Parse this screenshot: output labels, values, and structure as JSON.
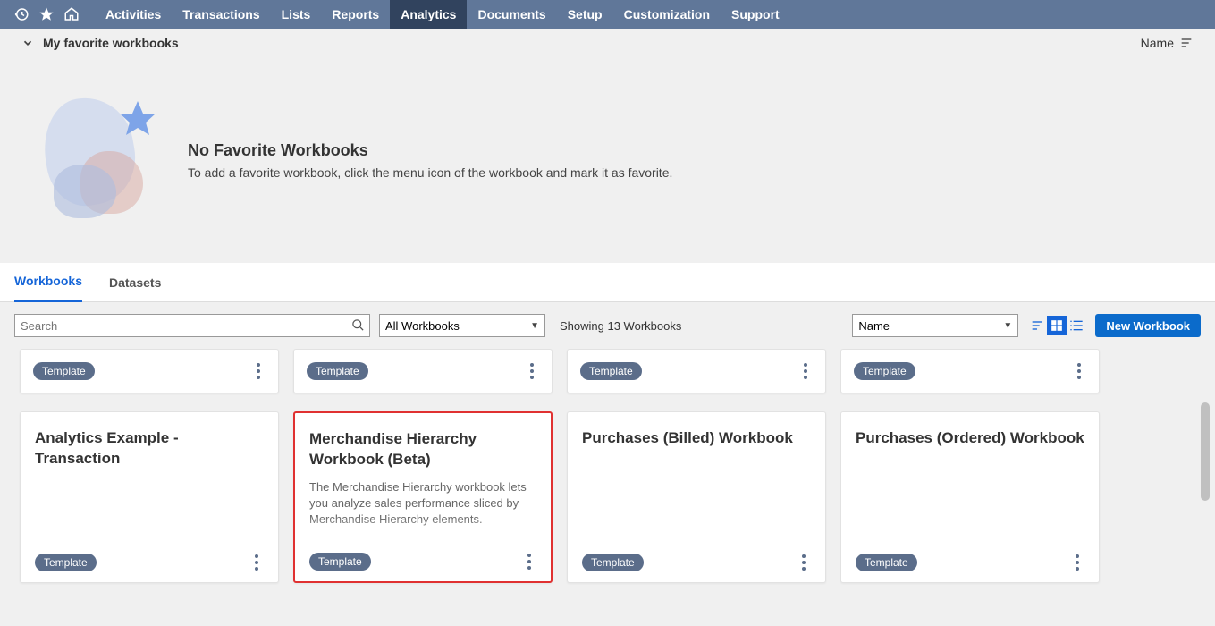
{
  "nav": {
    "items": [
      "Activities",
      "Transactions",
      "Lists",
      "Reports",
      "Analytics",
      "Documents",
      "Setup",
      "Customization",
      "Support"
    ],
    "active_index": 4
  },
  "favorites": {
    "header": "My favorite workbooks",
    "sort_label": "Name",
    "empty_title": "No Favorite Workbooks",
    "empty_text": "To add a favorite workbook, click the menu icon of the workbook and mark it as favorite."
  },
  "tabs": {
    "items": [
      "Workbooks",
      "Datasets"
    ],
    "active_index": 0
  },
  "toolbar": {
    "search_placeholder": "Search",
    "filter_value": "All Workbooks",
    "showing_text": "Showing 13 Workbooks",
    "sort_value": "Name",
    "new_button": "New Workbook"
  },
  "badge_label": "Template",
  "top_cards": [
    {
      "badge": "Template"
    },
    {
      "badge": "Template"
    },
    {
      "badge": "Template"
    },
    {
      "badge": "Template"
    }
  ],
  "cards": [
    {
      "title": "Analytics Example - Transaction",
      "desc": "",
      "badge": "Template",
      "highlight": false
    },
    {
      "title": "Merchandise Hierarchy Workbook (Beta)",
      "desc": "The Merchandise Hierarchy workbook lets you analyze sales performance sliced by Merchandise Hierarchy elements.",
      "badge": "Template",
      "highlight": true
    },
    {
      "title": "Purchases (Billed) Workbook",
      "desc": "",
      "badge": "Template",
      "highlight": false
    },
    {
      "title": "Purchases (Ordered) Workbook",
      "desc": "",
      "badge": "Template",
      "highlight": false
    }
  ]
}
